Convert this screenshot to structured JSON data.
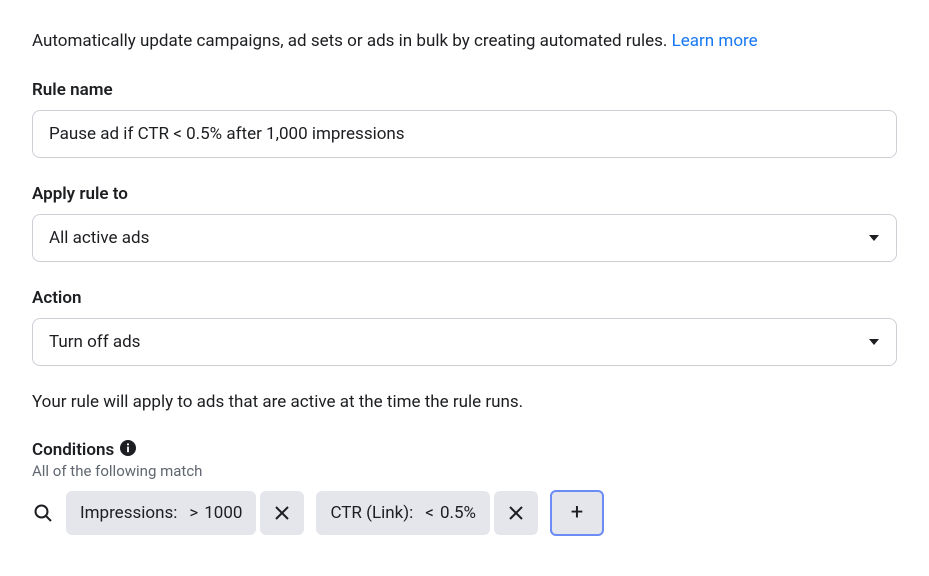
{
  "intro": {
    "text": "Automatically update campaigns, ad sets or ads in bulk by creating automated rules. ",
    "learn_more": "Learn more"
  },
  "rule_name": {
    "label": "Rule name",
    "value": "Pause ad if CTR < 0.5% after 1,000 impressions"
  },
  "apply_to": {
    "label": "Apply rule to",
    "value": "All active ads"
  },
  "action": {
    "label": "Action",
    "value": "Turn off ads"
  },
  "hint": "Your rule will apply to ads that are active at the time the rule runs.",
  "conditions": {
    "label": "Conditions",
    "sub": "All of the following match",
    "items": [
      {
        "metric": "Impressions:",
        "op": ">",
        "value": "1000"
      },
      {
        "metric": "CTR (Link):",
        "op": "<",
        "value": "0.5%"
      }
    ],
    "add_label": "+"
  }
}
